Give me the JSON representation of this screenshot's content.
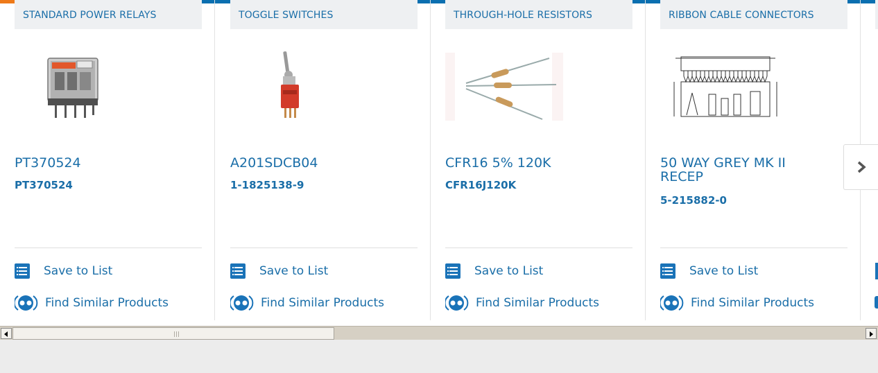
{
  "colors": {
    "brand_blue": "#0b6fb0",
    "accent_orange": "#ee7a19",
    "link_blue": "#1a6ea8"
  },
  "products": [
    {
      "category": "STANDARD POWER RELAYS",
      "title": "PT370524",
      "part_number": "PT370524",
      "image_icon": "relay-image",
      "save_label": "Save to List",
      "similar_label": "Find Similar Products"
    },
    {
      "category": "TOGGLE SWITCHES",
      "title": "A201SDCB04",
      "part_number": "1-1825138-9",
      "image_icon": "toggle-switch-image",
      "save_label": "Save to List",
      "similar_label": "Find Similar Products"
    },
    {
      "category": "THROUGH-HOLE RESISTORS",
      "title": "CFR16 5% 120K",
      "part_number": "CFR16J120K",
      "image_icon": "resistor-image",
      "save_label": "Save to List",
      "similar_label": "Find Similar Products"
    },
    {
      "category": "RIBBON CABLE CONNECTORS",
      "title": "50 WAY GREY MK II RECEP",
      "part_number": "5-215882-0",
      "image_icon": "connector-drawing-image",
      "save_label": "Save to List",
      "similar_label": "Find Similar Products"
    }
  ],
  "carousel": {
    "next_icon": "chevron-right-icon"
  },
  "scrollbar": {
    "left_arrow_icon": "arrow-left-icon",
    "right_arrow_icon": "arrow-right-icon"
  }
}
